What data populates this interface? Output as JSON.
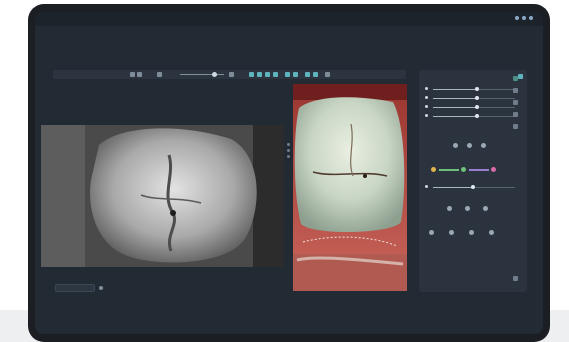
{
  "header": {
    "title": "",
    "subtitle": ""
  },
  "toolbar": {
    "buttons": [
      "undo-icon",
      "redo-icon",
      "zoom-out-icon",
      "zoom-in-icon",
      "rotate-icon",
      "flip-icon",
      "grid-icon",
      "measure-icon",
      "brightness-icon",
      "contrast-icon",
      "pen-icon",
      "text-icon",
      "settings-icon"
    ]
  },
  "panel": {
    "title": "",
    "section_title": ""
  },
  "footer": {
    "label": ""
  },
  "colors": {
    "accent": "#5fb3bf",
    "color_stops": [
      "#e0b44a",
      "#6fc07a",
      "#9a7fd0",
      "#d86aa8"
    ]
  }
}
